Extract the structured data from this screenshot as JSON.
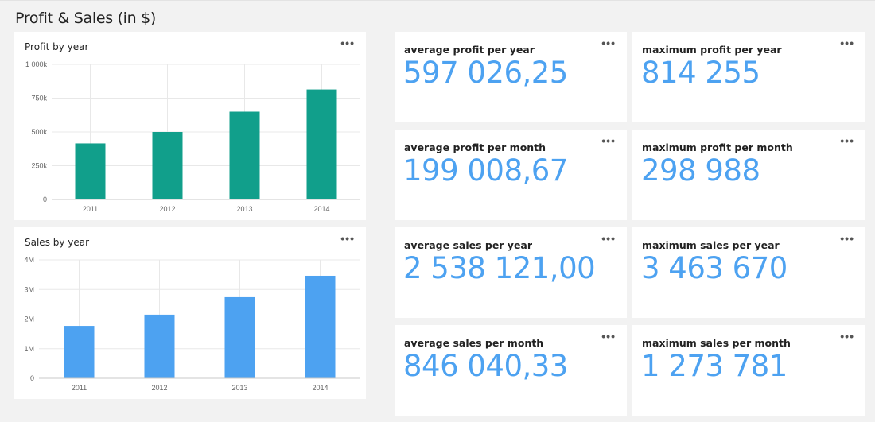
{
  "page": {
    "title": "Profit & Sales (in $)"
  },
  "menu_glyph": "•••",
  "charts": {
    "profit": {
      "title": "Profit by year",
      "color": "#119f8b"
    },
    "sales": {
      "title": "Sales by year",
      "color": "#4da2f1"
    }
  },
  "chart_data": [
    {
      "type": "bar",
      "title": "Profit by year",
      "categories": [
        "2011",
        "2012",
        "2013",
        "2014"
      ],
      "values": [
        415000,
        500000,
        650000,
        814255
      ],
      "ylim": [
        0,
        1000000
      ],
      "yticks": [
        0,
        250000,
        500000,
        750000,
        1000000
      ],
      "ytick_labels": [
        "0",
        "250k",
        "500k",
        "750k",
        "1 000k"
      ],
      "xlabel": "",
      "ylabel": "",
      "grid": true,
      "color": "#119f8b"
    },
    {
      "type": "bar",
      "title": "Sales by year",
      "categories": [
        "2011",
        "2012",
        "2013",
        "2014"
      ],
      "values": [
        1770000,
        2150000,
        2740000,
        3463670
      ],
      "ylim": [
        0,
        4000000
      ],
      "yticks": [
        0,
        1000000,
        2000000,
        3000000,
        4000000
      ],
      "ytick_labels": [
        "0",
        "1M",
        "2M",
        "3M",
        "4M"
      ],
      "xlabel": "",
      "ylabel": "",
      "grid": true,
      "color": "#4da2f1"
    }
  ],
  "kpis": [
    {
      "label": "average profit per year",
      "value": "597 026,25"
    },
    {
      "label": "maximum profit per year",
      "value": "814 255"
    },
    {
      "label": "average profit per month",
      "value": "199 008,67"
    },
    {
      "label": "maximum profit per month",
      "value": "298 988"
    },
    {
      "label": "average sales per year",
      "value": "2 538 121,00"
    },
    {
      "label": "maximum sales per year",
      "value": "3 463 670"
    },
    {
      "label": "average sales per month",
      "value": "846 040,33"
    },
    {
      "label": "maximum sales per month",
      "value": "1 273 781"
    }
  ]
}
